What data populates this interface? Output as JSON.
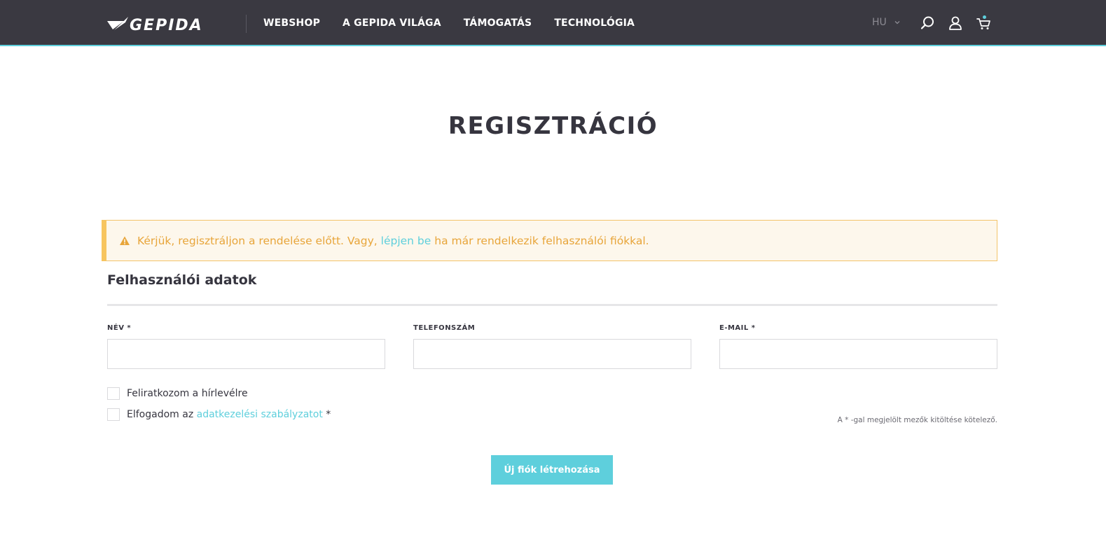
{
  "header": {
    "logo_text": "GEPIDA",
    "nav": [
      "WEBSHOP",
      "A GEPIDA VILÁGA",
      "TÁMOGATÁS",
      "TECHNOLÓGIA"
    ],
    "language": "HU",
    "icons": [
      "search-icon",
      "user-icon",
      "cart-icon"
    ],
    "colors": {
      "background": "#3a3941",
      "accent": "#5ecfdc"
    }
  },
  "page": {
    "title": "REGISZTRÁCIÓ"
  },
  "alert": {
    "text_before": "Kérjük, regisztráljon a rendelése előtt. Vagy, ",
    "link": "lépjen be",
    "text_after": " ha már rendelkezik felhasználói fiókkal.",
    "colors": {
      "text": "#e8a53a",
      "border": "#f7c55f",
      "background": "#fdf7ec"
    }
  },
  "form": {
    "section_title": "Felhasználói adatok",
    "fields": [
      {
        "label": "NÉV *",
        "value": ""
      },
      {
        "label": "TELEFONSZÁM",
        "value": ""
      },
      {
        "label": "E-MAIL *",
        "value": ""
      }
    ],
    "newsletter_label": "Feliratkozom a hírlevélre",
    "privacy_label_before": "Elfogadom az ",
    "privacy_link": "adatkezelési szabályzatot",
    "privacy_label_after": " *",
    "required_note": "A * -gal megjelölt mezők kitöltése kötelező.",
    "submit_label": "Új fiók létrehozása"
  }
}
